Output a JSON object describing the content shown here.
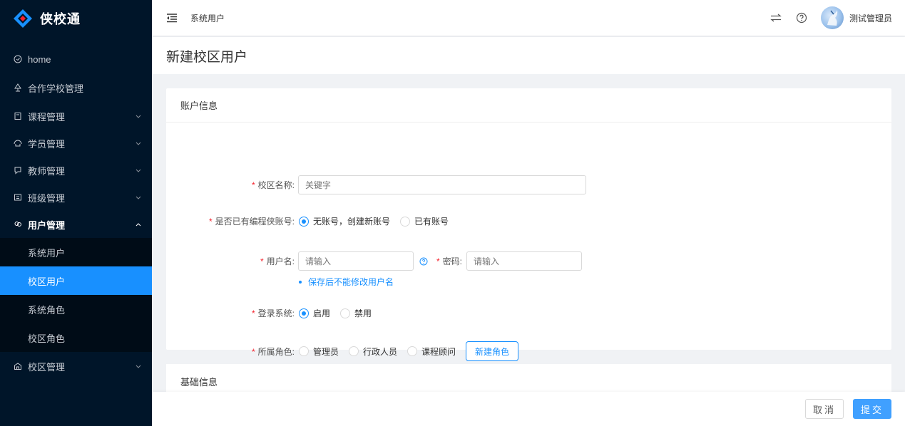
{
  "app": {
    "name": "侠校通",
    "brand_color": "#1890ff",
    "sidebar_bg": "#001529"
  },
  "sidebar": {
    "items": [
      {
        "label": "home",
        "icon": "clock-icon"
      },
      {
        "label": "合作学校管理",
        "icon": "tree-icon"
      },
      {
        "label": "课程管理",
        "icon": "book-icon"
      },
      {
        "label": "学员管理",
        "icon": "student-icon"
      },
      {
        "label": "教师管理",
        "icon": "teacher-icon"
      },
      {
        "label": "班级管理",
        "icon": "class-icon"
      },
      {
        "label": "用户管理",
        "icon": "users-icon"
      }
    ],
    "submenu": [
      {
        "label": "系统用户"
      },
      {
        "label": "校区用户",
        "selected": true
      },
      {
        "label": "系统角色"
      },
      {
        "label": "校区角色"
      }
    ],
    "after": [
      {
        "label": "校区管理",
        "icon": "campus-icon"
      }
    ]
  },
  "header": {
    "breadcrumb": "系统用户",
    "user_name": "测试管理员"
  },
  "page": {
    "title": "新建校区用户"
  },
  "account_card": {
    "title": "账户信息",
    "campus_name": {
      "label": "校区名称:",
      "placeholder": "关键字"
    },
    "has_account": {
      "label": "是否已有编程侠账号:",
      "options": [
        "无账号，创建新账号",
        "已有账号"
      ],
      "selected": 0
    },
    "username": {
      "label": "用户名:",
      "placeholder": "请输入",
      "hint": "保存后不能修改用户名"
    },
    "password": {
      "label": "密码:",
      "placeholder": "请输入"
    },
    "login": {
      "label": "登录系统:",
      "options": [
        "启用",
        "禁用"
      ],
      "selected": 0
    },
    "role": {
      "label": "所属角色:",
      "options": [
        "管理员",
        "行政人员",
        "课程顾问"
      ],
      "new_role_button": "新建角色"
    }
  },
  "basic_card": {
    "title": "基础信息"
  },
  "footer": {
    "cancel": "取消",
    "submit": "提交"
  }
}
